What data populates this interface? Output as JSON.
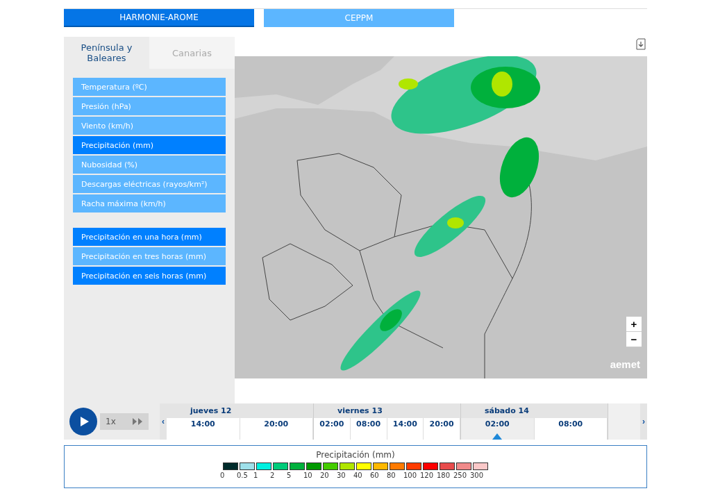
{
  "model_tabs": [
    {
      "label": "HARMONIE-AROME",
      "selected": true
    },
    {
      "label": "CEPPM",
      "selected": false
    }
  ],
  "region_tabs": [
    {
      "label": "Península y Baleares",
      "selected": true
    },
    {
      "label": "Canarias",
      "selected": false
    }
  ],
  "variables": [
    {
      "label": "Temperatura (ºC)",
      "selected": false
    },
    {
      "label": "Presión (hPa)",
      "selected": false
    },
    {
      "label": "Viento (km/h)",
      "selected": false
    },
    {
      "label": "Precipitación (mm)",
      "selected": true
    },
    {
      "label": "Nubosidad (%)",
      "selected": false
    },
    {
      "label": "Descargas eléctricas (rayos/km²)",
      "selected": false
    },
    {
      "label": "Racha máxima (km/h)",
      "selected": false
    }
  ],
  "accumulations": [
    {
      "label": "Precipitación en una hora (mm)",
      "selected": true
    },
    {
      "label": "Precipitación en tres horas (mm)",
      "selected": false
    },
    {
      "label": "Precipitación en seis horas (mm)",
      "selected": true
    }
  ],
  "map": {
    "logo": "aemet",
    "zoom_in": "+",
    "zoom_out": "−"
  },
  "player": {
    "speed": "1x"
  },
  "timeline": {
    "prev": "‹",
    "next": "›",
    "days": [
      {
        "label": "jueves 12",
        "times": [
          {
            "label": "14:00",
            "selected": false
          },
          {
            "label": "20:00",
            "selected": false
          }
        ]
      },
      {
        "label": "viernes 13",
        "times": [
          {
            "label": "02:00",
            "selected": false
          },
          {
            "label": "08:00",
            "selected": false
          },
          {
            "label": "14:00",
            "selected": false
          },
          {
            "label": "20:00",
            "selected": false
          }
        ]
      },
      {
        "label": "sábado 14",
        "times": [
          {
            "label": "02:00",
            "selected": true
          },
          {
            "label": "08:00",
            "selected": false
          }
        ]
      }
    ]
  },
  "legend": {
    "title": "Precipitación (mm)",
    "steps": [
      {
        "label": "0",
        "color": "#002b2b"
      },
      {
        "label": "0.5",
        "color": "#9ee0ea"
      },
      {
        "label": "1",
        "color": "#00f0e0"
      },
      {
        "label": "2",
        "color": "#00cc7a"
      },
      {
        "label": "5",
        "color": "#00b03c"
      },
      {
        "label": "10",
        "color": "#009900"
      },
      {
        "label": "20",
        "color": "#44cc00"
      },
      {
        "label": "30",
        "color": "#b0e600"
      },
      {
        "label": "40",
        "color": "#ffff00"
      },
      {
        "label": "60",
        "color": "#ffb800"
      },
      {
        "label": "80",
        "color": "#ff7a00"
      },
      {
        "label": "100",
        "color": "#ff3c00"
      },
      {
        "label": "120",
        "color": "#ff0000"
      },
      {
        "label": "180",
        "color": "#e84c4c"
      },
      {
        "label": "250",
        "color": "#f08a8a"
      },
      {
        "label": "300",
        "color": "#fac8c8"
      }
    ]
  }
}
